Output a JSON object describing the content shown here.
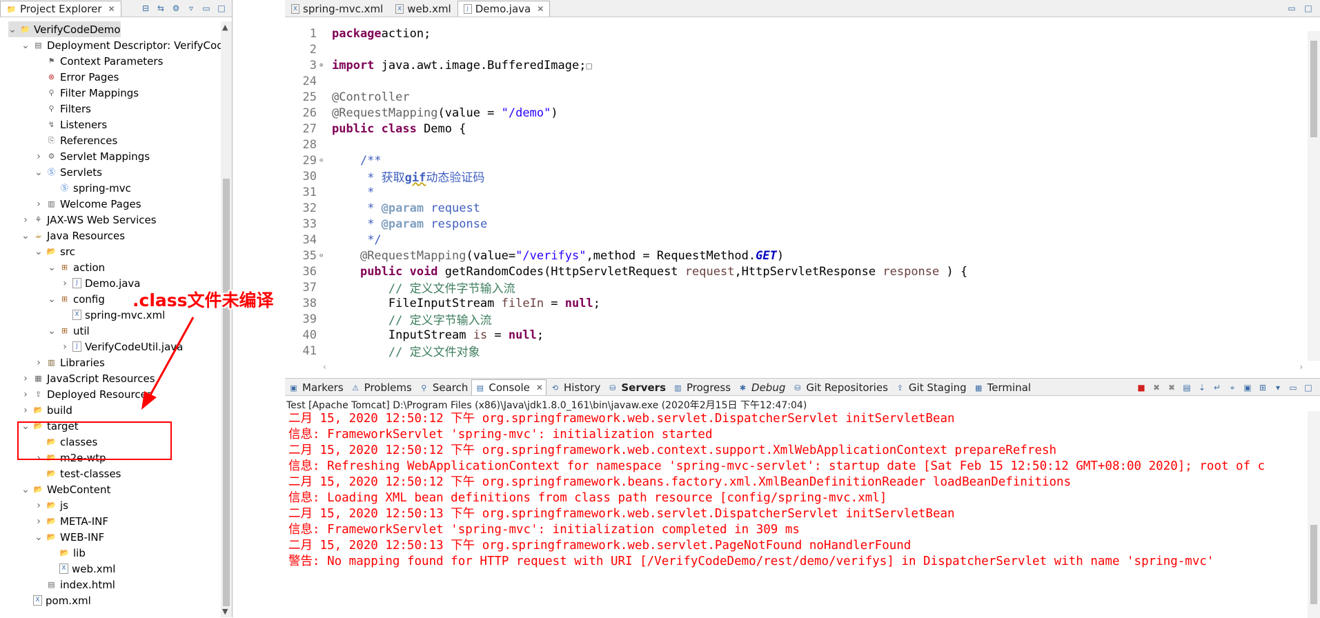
{
  "explorer": {
    "tab_label": "Project Explorer",
    "tree": [
      {
        "label": "VerifyCodeDemo",
        "icon": "project-icon",
        "level": 0,
        "twisty": "open",
        "selected": true
      },
      {
        "label": "Deployment Descriptor: VerifyCodeDemo",
        "icon": "descriptor-icon",
        "level": 1,
        "twisty": "open"
      },
      {
        "label": "Context Parameters",
        "icon": "context-params-icon",
        "level": 2,
        "twisty": ""
      },
      {
        "label": "Error Pages",
        "icon": "error-pages-icon",
        "level": 2,
        "twisty": ""
      },
      {
        "label": "Filter Mappings",
        "icon": "filter-mappings-icon",
        "level": 2,
        "twisty": ""
      },
      {
        "label": "Filters",
        "icon": "filters-icon",
        "level": 2,
        "twisty": ""
      },
      {
        "label": "Listeners",
        "icon": "listeners-icon",
        "level": 2,
        "twisty": ""
      },
      {
        "label": "References",
        "icon": "references-icon",
        "level": 2,
        "twisty": ""
      },
      {
        "label": "Servlet Mappings",
        "icon": "servlet-mappings-icon",
        "level": 2,
        "twisty": "closed"
      },
      {
        "label": "Servlets",
        "icon": "servlets-icon",
        "level": 2,
        "twisty": "open"
      },
      {
        "label": "spring-mvc",
        "icon": "servlet-icon",
        "level": 3,
        "twisty": ""
      },
      {
        "label": "Welcome Pages",
        "icon": "welcome-pages-icon",
        "level": 2,
        "twisty": "closed"
      },
      {
        "label": "JAX-WS Web Services",
        "icon": "web-services-icon",
        "level": 1,
        "twisty": "closed"
      },
      {
        "label": "Java Resources",
        "icon": "java-resources-icon",
        "level": 1,
        "twisty": "open"
      },
      {
        "label": "src",
        "icon": "source-folder-icon",
        "level": 2,
        "twisty": "open"
      },
      {
        "label": "action",
        "icon": "package-icon",
        "level": 3,
        "twisty": "open"
      },
      {
        "label": "Demo.java",
        "icon": "java-file-icon",
        "level": 4,
        "twisty": "closed"
      },
      {
        "label": "config",
        "icon": "package-icon",
        "level": 3,
        "twisty": "open"
      },
      {
        "label": "spring-mvc.xml",
        "icon": "xml-file-icon",
        "level": 4,
        "twisty": ""
      },
      {
        "label": "util",
        "icon": "package-icon",
        "level": 3,
        "twisty": "open"
      },
      {
        "label": "VerifyCodeUtil.java",
        "icon": "java-file-icon",
        "level": 4,
        "twisty": "closed"
      },
      {
        "label": "Libraries",
        "icon": "libraries-icon",
        "level": 2,
        "twisty": "closed"
      },
      {
        "label": "JavaScript Resources",
        "icon": "js-resources-icon",
        "level": 1,
        "twisty": "closed"
      },
      {
        "label": "Deployed Resources",
        "icon": "deployed-resources-icon",
        "level": 1,
        "twisty": "closed"
      },
      {
        "label": "build",
        "icon": "folder-icon",
        "level": 1,
        "twisty": "closed"
      },
      {
        "label": "target",
        "icon": "folder-icon",
        "level": 1,
        "twisty": "open"
      },
      {
        "label": "classes",
        "icon": "folder-icon",
        "level": 2,
        "twisty": ""
      },
      {
        "label": "m2e-wtp",
        "icon": "folder-icon",
        "level": 2,
        "twisty": "closed"
      },
      {
        "label": "test-classes",
        "icon": "folder-icon",
        "level": 2,
        "twisty": ""
      },
      {
        "label": "WebContent",
        "icon": "folder-icon",
        "level": 1,
        "twisty": "open"
      },
      {
        "label": "js",
        "icon": "folder-icon",
        "level": 2,
        "twisty": "closed"
      },
      {
        "label": "META-INF",
        "icon": "folder-icon",
        "level": 2,
        "twisty": "closed"
      },
      {
        "label": "WEB-INF",
        "icon": "folder-icon",
        "level": 2,
        "twisty": "open"
      },
      {
        "label": "lib",
        "icon": "folder-icon",
        "level": 3,
        "twisty": ""
      },
      {
        "label": "web.xml",
        "icon": "xml-file-icon",
        "level": 3,
        "twisty": ""
      },
      {
        "label": "index.html",
        "icon": "html-file-icon",
        "level": 2,
        "twisty": ""
      },
      {
        "label": "pom.xml",
        "icon": "xml-file-icon",
        "level": 1,
        "twisty": ""
      }
    ]
  },
  "editor": {
    "tabs": [
      {
        "label": "spring-mvc.xml",
        "icon": "xml-file-icon",
        "active": false
      },
      {
        "label": "web.xml",
        "icon": "xml-file-icon",
        "active": false
      },
      {
        "label": "Demo.java",
        "icon": "java-file-icon",
        "active": true
      }
    ],
    "lines": [
      {
        "n": "1",
        "fold": "",
        "segs": [
          [
            "kw",
            "package"
          ],
          [
            "",
            "action;"
          ]
        ]
      },
      {
        "n": "2",
        "fold": "",
        "segs": []
      },
      {
        "n": "3",
        "fold": "⊕",
        "segs": [
          [
            "kw",
            "import"
          ],
          [
            "",
            " java.awt.image.BufferedImage;"
          ],
          [
            "box",
            "□"
          ]
        ]
      },
      {
        "n": "24",
        "fold": "",
        "segs": []
      },
      {
        "n": "25",
        "fold": "",
        "segs": [
          [
            "an",
            "@Controller"
          ]
        ]
      },
      {
        "n": "26",
        "fold": "",
        "segs": [
          [
            "an",
            "@RequestMapping"
          ],
          [
            "",
            "(value = "
          ],
          [
            "str",
            "\"/demo\""
          ],
          [
            "",
            ")"
          ]
        ]
      },
      {
        "n": "27",
        "fold": "",
        "segs": [
          [
            "kw",
            "public class"
          ],
          [
            "",
            " Demo {"
          ]
        ]
      },
      {
        "n": "28",
        "fold": "",
        "segs": []
      },
      {
        "n": "29",
        "fold": "⊖",
        "segs": [
          [
            "",
            "    "
          ],
          [
            "jd",
            "/**"
          ]
        ]
      },
      {
        "n": "30",
        "fold": "",
        "segs": [
          [
            "",
            "     "
          ],
          [
            "jd",
            "* 获取"
          ],
          [
            "jdb",
            "gif"
          ],
          [
            "jd",
            "动态验证码"
          ]
        ]
      },
      {
        "n": "31",
        "fold": "",
        "segs": [
          [
            "",
            "     "
          ],
          [
            "jd",
            "*"
          ]
        ]
      },
      {
        "n": "32",
        "fold": "",
        "segs": [
          [
            "",
            "     "
          ],
          [
            "jd",
            "* "
          ],
          [
            "tag",
            "@param"
          ],
          [
            "jd",
            " request"
          ]
        ]
      },
      {
        "n": "33",
        "fold": "",
        "segs": [
          [
            "",
            "     "
          ],
          [
            "jd",
            "* "
          ],
          [
            "tag",
            "@param"
          ],
          [
            "jd",
            " response"
          ]
        ]
      },
      {
        "n": "34",
        "fold": "",
        "segs": [
          [
            "",
            "     "
          ],
          [
            "jd",
            "*/"
          ]
        ]
      },
      {
        "n": "35",
        "fold": "⊖",
        "segs": [
          [
            "",
            "    "
          ],
          [
            "an",
            "@RequestMapping"
          ],
          [
            "",
            "(value="
          ],
          [
            "str",
            "\"/verifys\""
          ],
          [
            "",
            ",method = RequestMethod."
          ],
          [
            "it",
            "GET"
          ],
          [
            "",
            ")"
          ]
        ]
      },
      {
        "n": "36",
        "fold": "",
        "segs": [
          [
            "",
            "    "
          ],
          [
            "kw",
            "public void"
          ],
          [
            "",
            " getRandomCodes(HttpServletRequest "
          ],
          [
            "pv",
            "request"
          ],
          [
            "",
            ",HttpServletResponse "
          ],
          [
            "pv",
            "response"
          ],
          [
            "",
            " ) {"
          ]
        ]
      },
      {
        "n": "37",
        "fold": "",
        "segs": [
          [
            "",
            "        "
          ],
          [
            "cm",
            "// 定义文件字节输入流"
          ]
        ]
      },
      {
        "n": "38",
        "fold": "",
        "segs": [
          [
            "",
            "        FileInputStream "
          ],
          [
            "pv",
            "fileIn"
          ],
          [
            "",
            " = "
          ],
          [
            "kw",
            "null"
          ],
          [
            "",
            ";"
          ]
        ]
      },
      {
        "n": "39",
        "fold": "",
        "segs": [
          [
            "",
            "        "
          ],
          [
            "cm",
            "// 定义字节输入流"
          ]
        ]
      },
      {
        "n": "40",
        "fold": "",
        "segs": [
          [
            "",
            "        InputStream "
          ],
          [
            "pv",
            "is"
          ],
          [
            "",
            " = "
          ],
          [
            "kw",
            "null"
          ],
          [
            "",
            ";"
          ]
        ]
      },
      {
        "n": "41",
        "fold": "",
        "segs": [
          [
            "",
            "        "
          ],
          [
            "cm",
            "// 定义文件对象"
          ]
        ]
      }
    ]
  },
  "console": {
    "tabs": [
      {
        "label": "Markers",
        "icon": "markers-icon",
        "active": false,
        "bold": false
      },
      {
        "label": "Problems",
        "icon": "problems-icon",
        "active": false,
        "bold": false
      },
      {
        "label": "Search",
        "icon": "search-icon",
        "active": false,
        "bold": false
      },
      {
        "label": "Console",
        "icon": "console-icon",
        "active": true,
        "bold": false
      },
      {
        "label": "History",
        "icon": "history-icon",
        "active": false,
        "bold": false
      },
      {
        "label": "Servers",
        "icon": "servers-icon",
        "active": false,
        "bold": true
      },
      {
        "label": "Progress",
        "icon": "progress-icon",
        "active": false,
        "bold": false
      },
      {
        "label": "Debug",
        "icon": "debug-icon",
        "active": false,
        "bold": false,
        "italic": true
      },
      {
        "label": "Git Repositories",
        "icon": "git-repositories-icon",
        "active": false,
        "bold": false
      },
      {
        "label": "Git Staging",
        "icon": "git-staging-icon",
        "active": false,
        "bold": false
      },
      {
        "label": "Terminal",
        "icon": "terminal-icon",
        "active": false,
        "bold": false
      }
    ],
    "title": "Test [Apache Tomcat] D:\\Program Files (x86)\\Java\\jdk1.8.0_161\\bin\\javaw.exe (2020年2月15日 下午12:47:04)",
    "lines": [
      "二月 15, 2020 12:50:12 下午 org.springframework.web.servlet.DispatcherServlet initServletBean",
      "信息: FrameworkServlet 'spring-mvc': initialization started",
      "二月 15, 2020 12:50:12 下午 org.springframework.web.context.support.XmlWebApplicationContext prepareRefresh",
      "信息: Refreshing WebApplicationContext for namespace 'spring-mvc-servlet': startup date [Sat Feb 15 12:50:12 GMT+08:00 2020]; root of c",
      "二月 15, 2020 12:50:12 下午 org.springframework.beans.factory.xml.XmlBeanDefinitionReader loadBeanDefinitions",
      "信息: Loading XML bean definitions from class path resource [config/spring-mvc.xml]",
      "二月 15, 2020 12:50:13 下午 org.springframework.web.servlet.DispatcherServlet initServletBean",
      "信息: FrameworkServlet 'spring-mvc': initialization completed in 309 ms",
      "二月 15, 2020 12:50:13 下午 org.springframework.web.servlet.PageNotFound noHandlerFound",
      "警告: No mapping found for HTTP request with URI [/VerifyCodeDemo/rest/demo/verifys] in DispatcherServlet with name 'spring-mvc'"
    ]
  },
  "annotation": {
    "label": ".class文件未编译",
    "color": "#ff0000"
  }
}
